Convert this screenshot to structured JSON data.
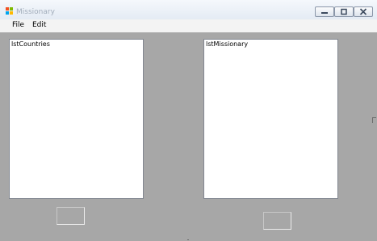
{
  "window": {
    "title": "Missionary",
    "icon": "windows-forms-app-icon"
  },
  "titlebar_controls": [
    {
      "name": "minimize-button",
      "icon": "minimize-icon"
    },
    {
      "name": "restore-button",
      "icon": "restore-icon"
    },
    {
      "name": "close-button",
      "icon": "close-icon"
    }
  ],
  "menu": {
    "items": [
      "File",
      "Edit"
    ]
  },
  "lists": {
    "countries": {
      "label": "lstCountries"
    },
    "missionary": {
      "label": "lstMissionary"
    }
  },
  "colors": {
    "form_background": "#a7a7a7",
    "listbox_background": "#ffffff",
    "menubar_background": "#f3f3f3"
  }
}
